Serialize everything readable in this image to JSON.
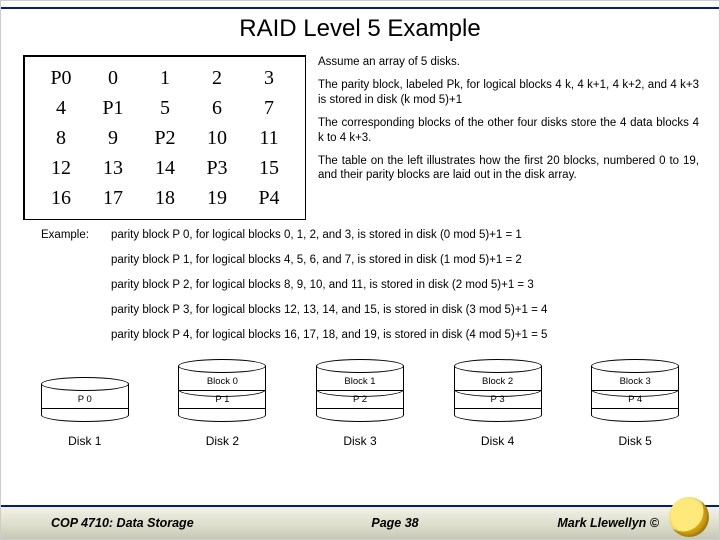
{
  "title": "RAID Level 5 Example",
  "matrix": [
    [
      "P0",
      "0",
      "1",
      "2",
      "3"
    ],
    [
      "4",
      "P1",
      "5",
      "6",
      "7"
    ],
    [
      "8",
      "9",
      "P2",
      "10",
      "11"
    ],
    [
      "12",
      "13",
      "14",
      "P3",
      "15"
    ],
    [
      "16",
      "17",
      "18",
      "19",
      "P4"
    ]
  ],
  "notes": {
    "p1": "Assume an array of 5 disks.",
    "p2": "The parity block, labeled Pk, for logical blocks 4 k, 4 k+1, 4 k+2, and 4 k+3 is stored in disk (k mod 5)+1",
    "p3": "The corresponding blocks of the other four disks store the 4 data blocks 4 k to 4 k+3.",
    "p4": "The table on the left illustrates how the first 20 blocks, numbered 0 to 19, and their parity blocks are laid out in the disk array."
  },
  "examples": {
    "lead": "Example:",
    "lines": [
      "parity block P 0, for logical blocks 0, 1, 2, and 3, is stored in disk (0 mod 5)+1 = 1",
      "parity block P 1, for logical blocks 4, 5, 6, and 7, is stored in disk (1 mod 5)+1 = 2",
      "parity block P 2, for logical blocks 8, 9, 10, and 11, is stored in disk (2 mod 5)+1 = 3",
      "parity block P 3, for logical blocks 12, 13, 14, and 15, is stored in disk (3 mod 5)+1 = 4",
      "parity block P 4, for logical blocks 16, 17, 18, and 19, is stored in disk (4 mod 5)+1 = 5"
    ]
  },
  "disks": [
    {
      "bands": [],
      "plabel": "P 0",
      "name": "Disk 1"
    },
    {
      "bands": [
        "Block 0"
      ],
      "plabel": "P 1",
      "name": "Disk 2"
    },
    {
      "bands": [
        "Block 1"
      ],
      "plabel": "P 2",
      "name": "Disk 3"
    },
    {
      "bands": [
        "Block 2"
      ],
      "plabel": "P 3",
      "name": "Disk 4"
    },
    {
      "bands": [
        "Block 3"
      ],
      "plabel": "P 4",
      "name": "Disk 5"
    }
  ],
  "footer": {
    "left": "COP 4710: Data Storage",
    "center": "Page 38",
    "right": "Mark Llewellyn ©"
  }
}
